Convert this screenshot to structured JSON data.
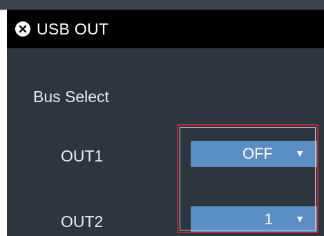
{
  "window": {
    "title": "USB OUT"
  },
  "bus_select": {
    "label": "Bus Select",
    "outputs": [
      {
        "label": "OUT1",
        "value": "OFF"
      },
      {
        "label": "OUT2",
        "value": "1"
      }
    ]
  },
  "icons": {
    "close": "close-icon",
    "dropdown": "chevron-down-icon"
  },
  "colors": {
    "header_bg": "#000000",
    "panel_bg": "#2d353f",
    "dropdown_bg": "#5b8fc3",
    "highlight_border": "#b3283a"
  }
}
